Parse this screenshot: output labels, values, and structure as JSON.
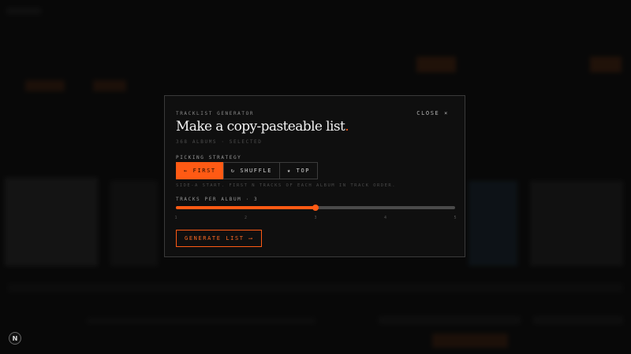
{
  "modal": {
    "eyebrow": "TRACKLIST GENERATOR",
    "close_label": "CLOSE ×",
    "title": "Make a copy-pasteable list",
    "title_accent": ".",
    "subtitle": "368 ALBUMS · SELECTED",
    "strategy_label": "PICKING STRATEGY",
    "strategies": [
      {
        "label": "← FIRST",
        "active": true
      },
      {
        "label": "↻ SHUFFLE",
        "active": false
      },
      {
        "label": "★ TOP",
        "active": false
      }
    ],
    "strategy_hint": "SIDE-A START. FIRST N TRACKS OF EACH ALBUM IN TRACK ORDER.",
    "tracks_label": "TRACKS PER ALBUM · 3",
    "slider": {
      "min": 1,
      "max": 5,
      "value": 3,
      "ticks": [
        "1",
        "2",
        "3",
        "4",
        "5"
      ]
    },
    "generate_label": "GENERATE LIST ⟶"
  },
  "logo_letter": "N",
  "colors": {
    "accent": "#ff5a14",
    "background": "#0b0b0b",
    "panel": "#0f0f0f"
  }
}
